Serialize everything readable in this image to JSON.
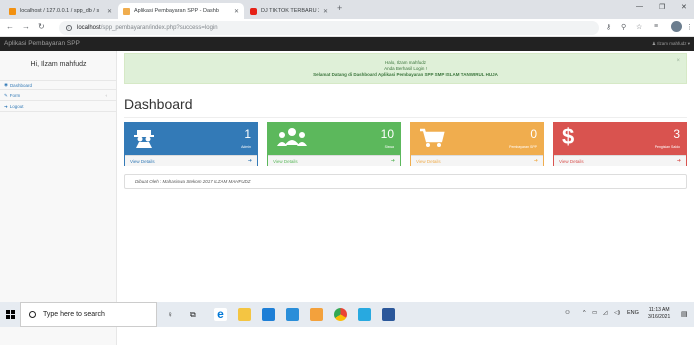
{
  "browser": {
    "tabs": [
      {
        "label": "localhost / 127.0.0.1 / spp_db / s"
      },
      {
        "label": "Aplikasi Pembayaran SPP - Dashb"
      },
      {
        "label": "DJ TIKTOK TERBARU 2021 -"
      }
    ],
    "url_host": "localhost",
    "url_path": "/spp_pembayaran/index.php?success=login"
  },
  "app": {
    "brand": "Aplikasi Pembayaran SPP",
    "user": "Ilzam mahfudz"
  },
  "sidebar": {
    "greeting": "Hi, Ilzam mahfudz",
    "items": [
      {
        "label": "Dashboard",
        "icon": "dashboard-icon"
      },
      {
        "label": "Form",
        "icon": "edit-icon"
      },
      {
        "label": "Logout",
        "icon": "logout-icon"
      }
    ]
  },
  "alert": {
    "line1": "Halo, Ilzam mahfudz",
    "line2": "Anda Berhasil Login !",
    "line3": "Selamat Datang di Dashboard Aplikasi Pembayaran SPP SMP ISLAM TANWIRUL HUJA"
  },
  "page_title": "Dashboard",
  "panels": [
    {
      "count": "1",
      "caption": "Admin",
      "link": "View Details",
      "icon": "spy-icon",
      "color": "#337ab7"
    },
    {
      "count": "10",
      "caption": "Siswa",
      "link": "View Details",
      "icon": "users-icon",
      "color": "#5cb85c"
    },
    {
      "count": "0",
      "caption": "Pembayaran SPP",
      "link": "View Details",
      "icon": "cart-icon",
      "color": "#f0ad4e"
    },
    {
      "count": "3",
      "caption": "Pengisian Saldo",
      "link": "View Details",
      "icon": "dollar-icon",
      "color": "#d9534f"
    }
  ],
  "footer_note": "Dibuat Oleh : Mahasiswa Stekom 2017 ILZAM MAHFUDZ",
  "taskbar": {
    "search_placeholder": "Type here to search",
    "lang": "ENG",
    "time": "11:13 AM",
    "date": "3/16/2021"
  }
}
